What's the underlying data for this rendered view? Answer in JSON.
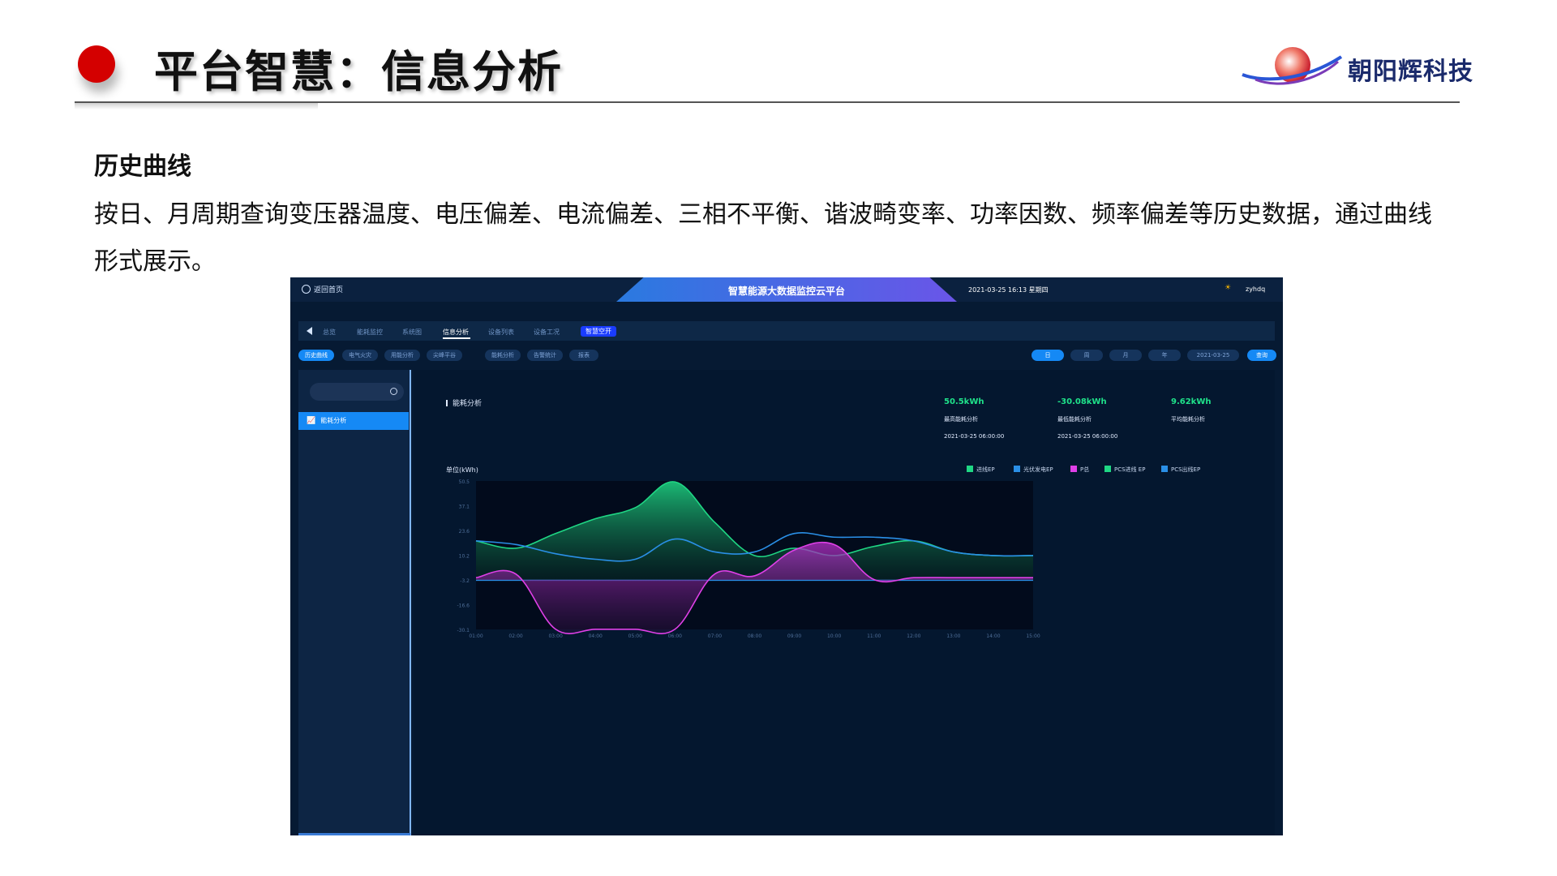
{
  "header": {
    "title": "平台智慧：信息分析",
    "company": "朝阳辉科技"
  },
  "section": {
    "heading": "历史曲线",
    "description": "按日、月周期查询变压器温度、电压偏差、电流偏差、三相不平衡、谐波畸变率、功率因数、频率偏差等历史数据，通过曲线形式展示。"
  },
  "app": {
    "back_label": "返回首页",
    "platform_title": "智慧能源大数据监控云平台",
    "datetime": "2021-03-25 16:13 星期四",
    "username": "zyhdq",
    "nav": [
      "总览",
      "能耗监控",
      "系统图",
      "信息分析",
      "设备列表",
      "设备工况"
    ],
    "nav_switch": "智慧空开",
    "subtabs": [
      "历史曲线",
      "电气火灾",
      "用能分析",
      "尖峰平谷",
      "能耗分析",
      "告警统计",
      "报表"
    ],
    "periods": [
      "日",
      "周",
      "月",
      "年"
    ],
    "date_value": "2021-03-25",
    "query_label": "查询",
    "sidebar_item": "能耗分析",
    "panel_title": "能耗分析",
    "stats": [
      {
        "value": "50.5kWh",
        "label": "最高能耗分析",
        "time": "2021-03-25 06:00:00"
      },
      {
        "value": "-30.08kWh",
        "label": "最低能耗分析",
        "time": "2021-03-25 06:00:00"
      },
      {
        "value": "9.62kWh",
        "label": "平均能耗分析",
        "time": ""
      }
    ],
    "unit_label": "单位(kWh)"
  },
  "colors": {
    "green": "#1fd784",
    "blue": "#2a8fe6",
    "magenta": "#e040e8",
    "accent": "#1589f5"
  },
  "chart_data": {
    "type": "area",
    "ylabel": "单位(kWh)",
    "ylim": [
      -30.1,
      50.5
    ],
    "yticks": [
      "50.5",
      "37.1",
      "23.6",
      "10.2",
      "-3.2",
      "-16.6",
      "-30.1"
    ],
    "x": [
      "01:00",
      "02:00",
      "03:00",
      "04:00",
      "05:00",
      "06:00",
      "07:00",
      "08:00",
      "09:00",
      "10:00",
      "11:00",
      "12:00",
      "13:00",
      "14:00",
      "15:00"
    ],
    "series": [
      {
        "name": "进线EP",
        "color": "#1fd784",
        "fill": true,
        "values": [
          18,
          14,
          22,
          30,
          36,
          50,
          28,
          10,
          14,
          10,
          15,
          18,
          12,
          10,
          10
        ]
      },
      {
        "name": "光伏发电EP",
        "color": "#2a8fe6",
        "fill": false,
        "values": [
          18,
          16,
          11,
          8,
          8,
          19,
          12,
          12,
          22,
          20,
          20,
          18,
          12,
          10,
          10
        ]
      },
      {
        "name": "P总",
        "color": "#e040e8",
        "fill": true,
        "values": [
          -2,
          0,
          -30,
          -30,
          -30,
          -30,
          0,
          -1,
          13,
          16,
          -3,
          -2,
          -2,
          -2,
          -2
        ]
      },
      {
        "name": "PCS进线 EP",
        "color": "#1fd784",
        "fill": false,
        "values": []
      },
      {
        "name": "PCS出线EP",
        "color": "#2a8fe6",
        "fill": false,
        "values": []
      }
    ]
  }
}
